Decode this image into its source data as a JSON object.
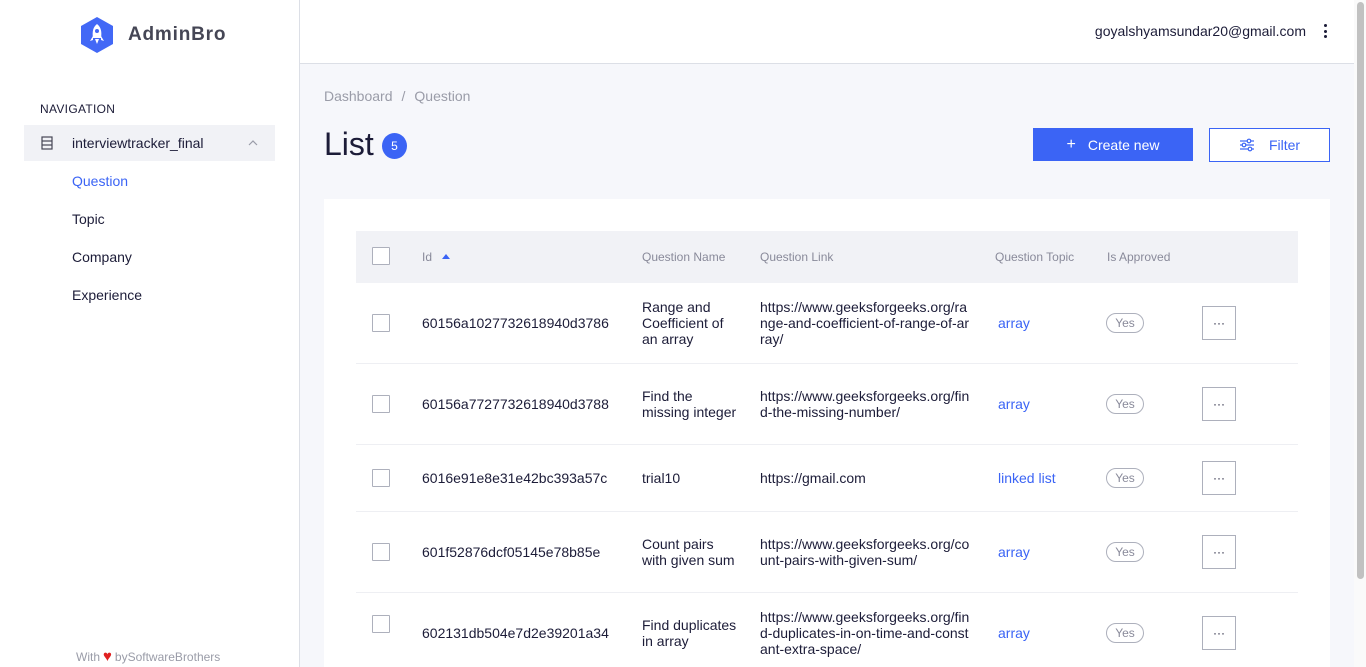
{
  "brand": {
    "name": "AdminBro"
  },
  "sidebar": {
    "nav_title": "NAVIGATION",
    "group": {
      "label": "interviewtracker_final"
    },
    "items": [
      {
        "label": "Question",
        "active": true
      },
      {
        "label": "Topic",
        "active": false
      },
      {
        "label": "Company",
        "active": false
      },
      {
        "label": "Experience",
        "active": false
      }
    ],
    "footer": {
      "prefix": "With",
      "suffix": "bySoftwareBrothers"
    }
  },
  "topbar": {
    "user_email": "goyalshyamsundar20@gmail.com"
  },
  "breadcrumb": {
    "first": "Dashboard",
    "separator": "/",
    "second": "Question"
  },
  "page": {
    "title": "List",
    "count": "5",
    "create_label": "Create new",
    "filter_label": "Filter"
  },
  "table": {
    "columns": {
      "id": "Id",
      "name": "Question Name",
      "link": "Question Link",
      "topic": "Question Topic",
      "approved": "Is Approved"
    },
    "rows": [
      {
        "id": "60156a1027732618940d3786",
        "name": "Range and Coefficient of an array",
        "link": "https://www.geeksforgeeks.org/range-and-coefficient-of-range-of-array/",
        "topic": "array",
        "approved": "Yes"
      },
      {
        "id": "60156a7727732618940d3788",
        "name": "Find the missing integer",
        "link": "https://www.geeksforgeeks.org/find-the-missing-number/",
        "topic": "array",
        "approved": "Yes"
      },
      {
        "id": "6016e91e8e31e42bc393a57c",
        "name": "trial10",
        "link": "https://gmail.com",
        "topic": "linked list",
        "approved": "Yes"
      },
      {
        "id": "601f52876dcf05145e78b85e",
        "name": "Count pairs with given sum",
        "link": "https://www.geeksforgeeks.org/count-pairs-with-given-sum/",
        "topic": "array",
        "approved": "Yes"
      },
      {
        "id": "602131db504e7d2e39201a34",
        "name": "Find duplicates in array",
        "link": "https://www.geeksforgeeks.org/find-duplicates-in-on-time-and-constant-extra-space/",
        "topic": "array",
        "approved": "Yes"
      }
    ],
    "actions_label": "···"
  },
  "colors": {
    "accent": "#3b64f5",
    "text": "#1c1c38",
    "muted": "#898a9a",
    "heart": "#e02020"
  }
}
